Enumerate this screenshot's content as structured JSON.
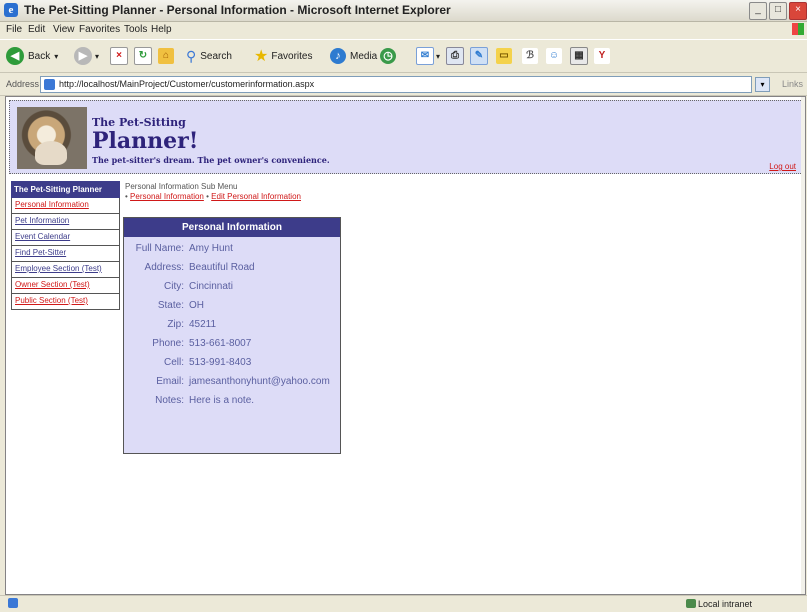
{
  "window": {
    "title": "The Pet-Sitting Planner - Personal Information - Microsoft Internet Explorer"
  },
  "menu": [
    "File",
    "Edit",
    "View",
    "Favorites",
    "Tools",
    "Help"
  ],
  "toolbar": {
    "back": "Back",
    "search": "Search",
    "favorites": "Favorites",
    "media": "Media"
  },
  "address": {
    "label": "Address",
    "url": "http://localhost/MainProject/Customer/customerinformation.aspx",
    "links": "Links"
  },
  "header": {
    "brand_top": "The Pet-Sitting",
    "brand_main": "Planner!",
    "tagline": "The pet-sitter's dream. The pet owner's convenience.",
    "logout": "Log out"
  },
  "sidebar": {
    "title": "The Pet-Sitting Planner",
    "items": [
      {
        "label": "Personal Information",
        "color": "red"
      },
      {
        "label": "Pet Information",
        "color": "blue"
      },
      {
        "label": "Event Calendar",
        "color": "blue"
      },
      {
        "label": "Find Pet-Sitter",
        "color": "blue"
      },
      {
        "label": "Employee Section (Test)",
        "color": "blue"
      },
      {
        "label": "Owner Section (Test)",
        "color": "red"
      },
      {
        "label": "Public Section (Test)",
        "color": "red"
      }
    ]
  },
  "submenu": {
    "title": "Personal Information Sub Menu",
    "bullet": "•",
    "sep": "•",
    "link1": "Personal Information",
    "link2": "Edit Personal Information"
  },
  "panel": {
    "title": "Personal Information",
    "fields": [
      {
        "label": "Full Name:",
        "value": "Amy Hunt"
      },
      {
        "label": "Address:",
        "value": "Beautiful Road"
      },
      {
        "label": "City:",
        "value": "Cincinnati"
      },
      {
        "label": "State:",
        "value": "OH"
      },
      {
        "label": "Zip:",
        "value": "45211"
      },
      {
        "label": "Phone:",
        "value": "513-661-8007"
      },
      {
        "label": "Cell:",
        "value": "513-991-8403"
      },
      {
        "label": "Email:",
        "value": "jamesanthonyhunt@yahoo.com"
      },
      {
        "label": "Notes:",
        "value": "Here is a note."
      }
    ]
  },
  "status": {
    "zone": "Local intranet"
  },
  "colors": {
    "accent": "#3d3c8a",
    "panel_bg": "#dddcf7",
    "link_red": "#d01818"
  }
}
